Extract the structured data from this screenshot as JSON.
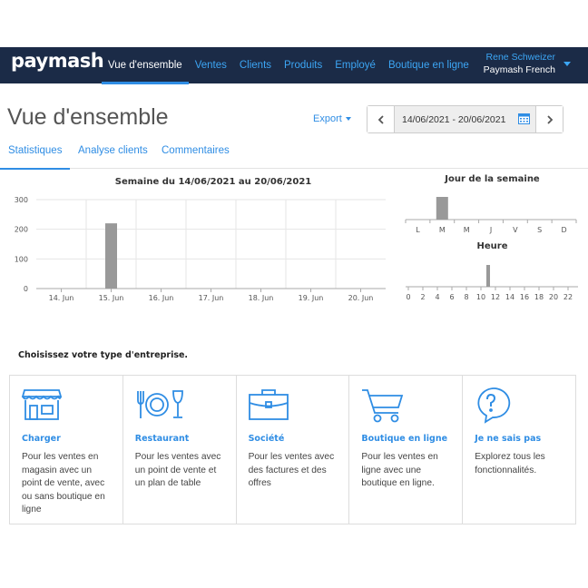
{
  "header": {
    "logo": "paymash",
    "nav": [
      {
        "label": "Vue d'ensemble",
        "active": true
      },
      {
        "label": "Ventes"
      },
      {
        "label": "Clients"
      },
      {
        "label": "Produits"
      },
      {
        "label": "Employé"
      },
      {
        "label": "Boutique en ligne"
      }
    ],
    "user_name": "Rene Schweizer",
    "user_org": "Paymash French"
  },
  "page": {
    "title": "Vue d'ensemble",
    "export_label": "Export",
    "date_range": "14/06/2021 - 20/06/2021"
  },
  "tabs": [
    {
      "label": "Statistiques",
      "active": true
    },
    {
      "label": "Analyse clients"
    },
    {
      "label": "Commentaires"
    }
  ],
  "charts": {
    "weekly": {
      "title": "Semaine du 14/06/2021 au 20/06/2021",
      "type": "bar",
      "categories": [
        "14. Jun",
        "15. Jun",
        "16. Jun",
        "17. Jun",
        "18. Jun",
        "19. Jun",
        "20. Jun"
      ],
      "values": [
        0,
        220,
        0,
        0,
        0,
        0,
        0
      ],
      "yticks": [
        "0",
        "100",
        "200",
        "300"
      ],
      "ylim": [
        0,
        300
      ]
    },
    "weekday": {
      "title": "Jour de la semaine",
      "type": "bar",
      "categories": [
        "L",
        "M",
        "M",
        "J",
        "V",
        "S",
        "D"
      ],
      "values": [
        0,
        220,
        0,
        0,
        0,
        0,
        0
      ]
    },
    "hour": {
      "title": "Heure",
      "type": "bar",
      "ticks": [
        "0",
        "2",
        "4",
        "6",
        "8",
        "10",
        "12",
        "14",
        "16",
        "18",
        "20",
        "22"
      ],
      "values": {
        "11": 220
      }
    }
  },
  "chart_data": [
    {
      "type": "bar",
      "title": "Semaine du 14/06/2021 au 20/06/2021",
      "categories": [
        "14. Jun",
        "15. Jun",
        "16. Jun",
        "17. Jun",
        "18. Jun",
        "19. Jun",
        "20. Jun"
      ],
      "values": [
        0,
        220,
        0,
        0,
        0,
        0,
        0
      ],
      "ylim": [
        0,
        300
      ],
      "grid": true
    },
    {
      "type": "bar",
      "title": "Jour de la semaine",
      "categories": [
        "L",
        "M",
        "M",
        "J",
        "V",
        "S",
        "D"
      ],
      "values": [
        0,
        220,
        0,
        0,
        0,
        0,
        0
      ]
    },
    {
      "type": "bar",
      "title": "Heure",
      "categories": [
        "0",
        "1",
        "2",
        "3",
        "4",
        "5",
        "6",
        "7",
        "8",
        "9",
        "10",
        "11",
        "12",
        "13",
        "14",
        "15",
        "16",
        "17",
        "18",
        "19",
        "20",
        "21",
        "22",
        "23"
      ],
      "values": [
        0,
        0,
        0,
        0,
        0,
        0,
        0,
        0,
        0,
        0,
        0,
        220,
        0,
        0,
        0,
        0,
        0,
        0,
        0,
        0,
        0,
        0,
        0,
        0
      ]
    }
  ],
  "business": {
    "heading": "Choisissez votre type d'entreprise.",
    "cards": [
      {
        "icon": "storefront-icon",
        "title": "Charger",
        "desc": "Pour les ventes en magasin avec un point de vente, avec ou sans boutique en ligne"
      },
      {
        "icon": "cutlery-plate-glass-icon",
        "title": "Restaurant",
        "desc": "Pour les ventes avec un point de vente et un plan de table"
      },
      {
        "icon": "briefcase-icon",
        "title": "Société",
        "desc": "Pour les ventes avec des factures et des offres"
      },
      {
        "icon": "shopping-cart-icon",
        "title": "Boutique en ligne",
        "desc": "Pour les ventes en ligne avec une boutique en ligne."
      },
      {
        "icon": "question-bubble-icon",
        "title": "Je ne sais pas",
        "desc": "Explorez tous les fonctionnalités."
      }
    ]
  },
  "colors": {
    "topbar": "#1b2b47",
    "accent": "#2f8de4",
    "bar": "#999999"
  }
}
